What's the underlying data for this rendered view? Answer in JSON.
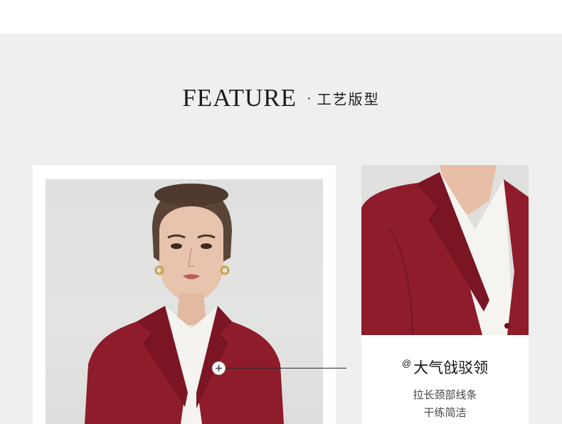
{
  "heading": {
    "english": "FEATURE",
    "separator": "·",
    "chinese": "工艺版型"
  },
  "feature_caption": {
    "marker": "@",
    "title": "大气戗驳领",
    "line1": "拉长颈部线条",
    "line2": "干练简洁"
  },
  "hotspot": {
    "symbol": "+"
  },
  "colors": {
    "background_panel": "#efefef",
    "blazer_burgundy": "#8e1c2b",
    "text_dark": "#1c1c1c"
  }
}
